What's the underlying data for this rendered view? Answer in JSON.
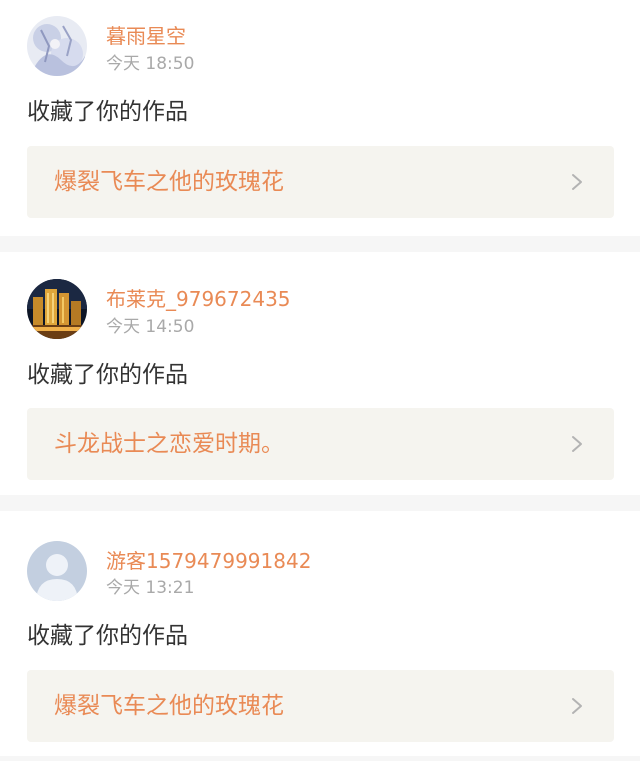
{
  "notifications": [
    {
      "username": "暮雨星空",
      "time": "今天 18:50",
      "action": "收藏了你的作品",
      "work_title": "爆裂飞车之他的玫瑰花",
      "avatar_icon": "anime-illustration-avatar"
    },
    {
      "username": "布莱克_979672435",
      "time": "今天 14:50",
      "action": "收藏了你的作品",
      "work_title": "斗龙战士之恋爱时期。",
      "avatar_icon": "night-city-photo-avatar"
    },
    {
      "username": "游客1579479991842",
      "time": "今天 13:21",
      "action": "收藏了你的作品",
      "work_title": "爆裂飞车之他的玫瑰花",
      "avatar_icon": "default-user-avatar"
    }
  ],
  "colors": {
    "accent": "#e98a55",
    "time_gray": "#a9a9a9",
    "text_dark": "#333333",
    "work_box_bg": "#f5f4ef",
    "separator": "#f6f6f6"
  }
}
